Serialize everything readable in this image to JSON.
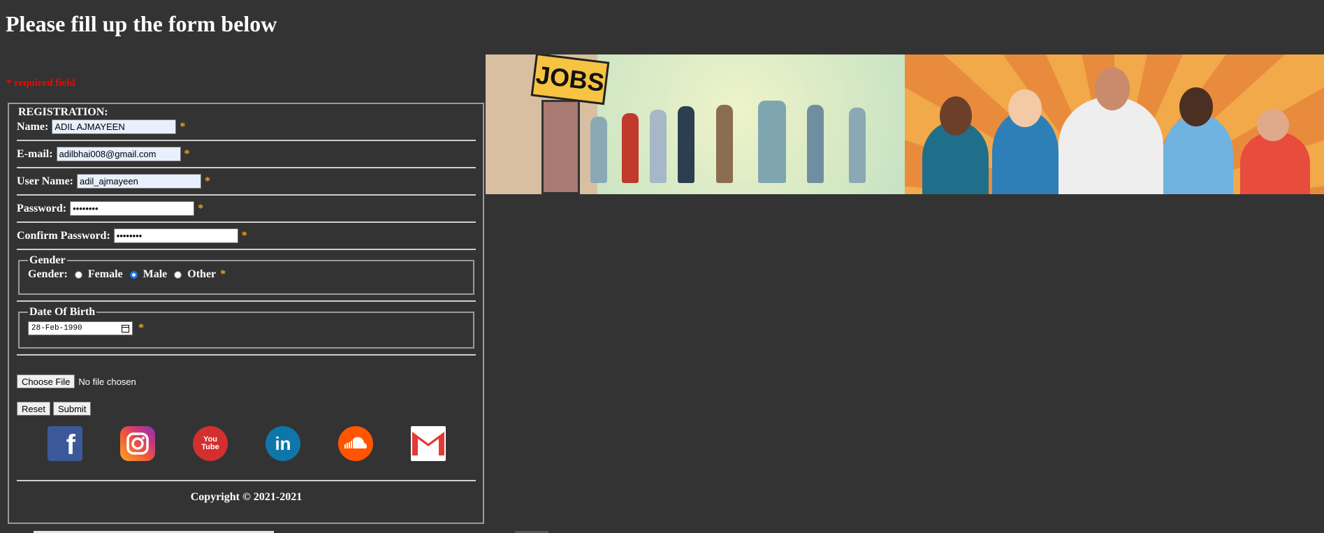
{
  "page": {
    "title": "Please fill up the form below",
    "required_note": "* required field"
  },
  "form": {
    "section_title": "REGISTRATION:",
    "required_star": "*",
    "name": {
      "label": "Name:",
      "value": "ADIL AJMAYEEN"
    },
    "email": {
      "label": "E-mail:",
      "value": "adilbhai008@gmail.com"
    },
    "username": {
      "label": "User Name:",
      "value": "adil_ajmayeen"
    },
    "password": {
      "label": "Password:",
      "value": "••••••••"
    },
    "confirm_password": {
      "label": "Confirm Password:",
      "value": "••••••••"
    },
    "gender": {
      "legend": "Gender",
      "label": "Gender:",
      "options": [
        "Female",
        "Male",
        "Other"
      ],
      "selected": "Male"
    },
    "dob": {
      "legend": "Date Of Birth",
      "value": "28-Feb-1990"
    },
    "file": {
      "button_label": "Choose File",
      "status": "No file chosen"
    },
    "buttons": {
      "reset": "Reset",
      "submit": "Submit"
    }
  },
  "social": {
    "icons": [
      "facebook-icon",
      "instagram-icon",
      "youtube-icon",
      "linkedin-icon",
      "soundcloud-icon",
      "gmail-icon"
    ],
    "glyphs": {
      "facebook": "f",
      "youtube": "You Tube",
      "linkedin": "in"
    }
  },
  "banner": {
    "sign_text": "JOBS"
  },
  "footer": {
    "copyright": "Copyright © 2021-2021"
  },
  "colors": {
    "background": "#333333",
    "required": "#ff0000",
    "star": "#f5a623",
    "autofill": "#e8f0fe",
    "radio_checked": "#1a73e8"
  }
}
